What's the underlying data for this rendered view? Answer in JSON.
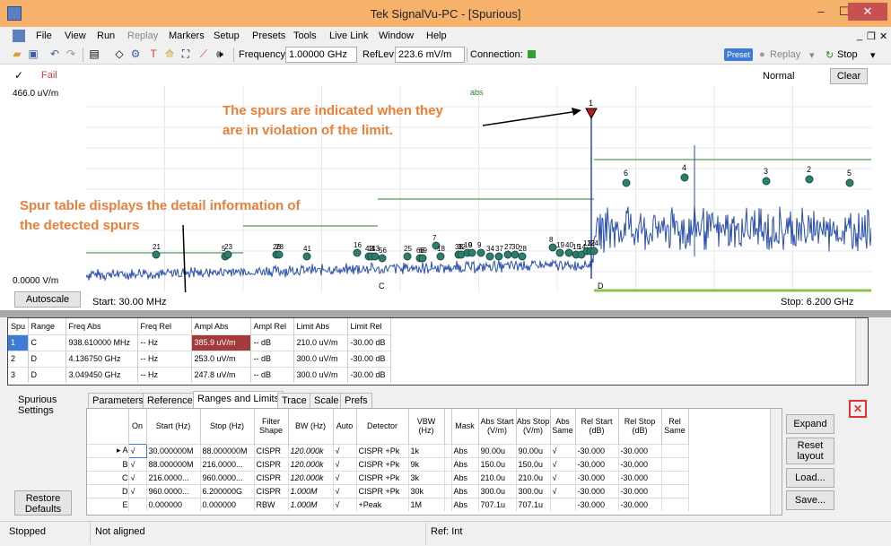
{
  "window": {
    "title": "Tek SignalVu-PC - [Spurious]",
    "minimize": "–",
    "maximize": "☐",
    "close": "✕"
  },
  "menu": [
    "File",
    "View",
    "Run",
    "Replay",
    "Markers",
    "Setup",
    "Presets",
    "Tools",
    "Live Link",
    "Window",
    "Help"
  ],
  "toolbar": {
    "frequency_label": "Frequency:",
    "frequency_value": "1.00000 GHz",
    "reflev_label": "RefLev:",
    "reflev_value": "223.6 mV/m",
    "connection_label": "Connection:",
    "connection_color": "#2ea32e",
    "preset_label": "Preset",
    "replay_label": "Replay",
    "stop_label": "Stop"
  },
  "status": {
    "check": "✓",
    "result": "Fail",
    "mode": "Normal",
    "clear_label": "Clear"
  },
  "plot": {
    "y_top": "466.0 uV/m",
    "y_bottom": "0.0000 V/m",
    "trace_label": "abs",
    "autoscale_label": "Autoscale",
    "start": "Start: 30.00 MHz",
    "stop": "Stop: 6.200 GHz",
    "range_c_label": "C",
    "range_d_label": "D",
    "markers_low": [
      "21",
      "5",
      "23",
      "26",
      "28",
      "41",
      "16",
      "42",
      "11",
      "43",
      "56",
      "25",
      "66",
      "69",
      "7",
      "18",
      "38",
      "32",
      "10",
      "9",
      "9",
      "34",
      "37",
      "27",
      "30",
      "28",
      "8",
      "19",
      "40",
      "15",
      "14",
      "13",
      "12",
      "24"
    ],
    "markers_high": [
      {
        "label": "1",
        "color": "#000000"
      },
      {
        "label": "6",
        "color": "#2e7d6e"
      },
      {
        "label": "4",
        "color": "#2e7d6e"
      },
      {
        "label": "3",
        "color": "#2e7d6e"
      },
      {
        "label": "2",
        "color": "#2e7d6e"
      },
      {
        "label": "5",
        "color": "#2e7d6e"
      }
    ],
    "trace_color": "#2a4fb0",
    "limit_color": "#2f7d32"
  },
  "annotations": {
    "spurs": [
      "The spurs are indicated when they",
      "are in violation of the limit."
    ],
    "table": [
      "Spur table displays the detail information of",
      "the detected spurs"
    ],
    "color": "#e8803a"
  },
  "spur_table": {
    "headers": [
      "Spu",
      "Range",
      "Freq Abs",
      "Freq Rel",
      "Ampl Abs",
      "Ampl Rel",
      "Limit Abs",
      "Limit Rel"
    ],
    "rows": [
      [
        "1",
        "C",
        "938.610000 MHz",
        "-- Hz",
        "385.9 uV/m",
        "-- dB",
        "210.0 uV/m",
        "-30.00 dB"
      ],
      [
        "2",
        "D",
        "4.136750 GHz",
        "-- Hz",
        "253.0 uV/m",
        "-- dB",
        "300.0 uV/m",
        "-30.00 dB"
      ],
      [
        "3",
        "D",
        "3.049450 GHz",
        "-- Hz",
        "247.8 uV/m",
        "-- dB",
        "300.0 uV/m",
        "-30.00 dB"
      ]
    ]
  },
  "settings": {
    "title_line1": "Spurious",
    "title_line2": "Settings",
    "tabs": [
      "Parameters",
      "Reference",
      "Ranges and Limits",
      "Trace",
      "Scale",
      "Prefs"
    ],
    "restore_line1": "Restore",
    "restore_line2": "Defaults",
    "buttons": [
      "Expand",
      "Reset layout",
      "Load...",
      "Save..."
    ],
    "close_icon": "✕",
    "range_headers": [
      "",
      "On",
      "Start (Hz)",
      "Stop (Hz)",
      "Filter Shape",
      "BW (Hz)",
      "Auto",
      "Detector",
      "VBW (Hz)",
      "",
      "Mask",
      "Abs Start (V/m)",
      "Abs Stop (V/m)",
      "Abs Same",
      "Rel Start (dB)",
      "Rel Stop (dB)",
      "Rel Same"
    ],
    "range_rows": [
      [
        "▸ A",
        "√",
        "30.000000M",
        "88.000000M",
        "CISPR",
        "120.000k",
        "√",
        "CISPR +Pk",
        "1k",
        "",
        "Abs",
        "90.00u",
        "90.00u",
        "√",
        "-30.000",
        "-30.000",
        ""
      ],
      [
        "B",
        "√",
        "88.000000M",
        "216.0000...",
        "CISPR",
        "120.000k",
        "√",
        "CISPR +Pk",
        "9k",
        "",
        "Abs",
        "150.0u",
        "150.0u",
        "√",
        "-30.000",
        "-30.000",
        ""
      ],
      [
        "C",
        "√",
        "216.0000...",
        "960.0000...",
        "CISPR",
        "120.000k",
        "√",
        "CISPR +Pk",
        "3k",
        "",
        "Abs",
        "210.0u",
        "210.0u",
        "√",
        "-30.000",
        "-30.000",
        ""
      ],
      [
        "D",
        "√",
        "960.0000...",
        "6.200000G",
        "CISPR",
        "1.000M",
        "√",
        "CISPR +Pk",
        "30k",
        "",
        "Abs",
        "300.0u",
        "300.0u",
        "√",
        "-30.000",
        "-30.000",
        ""
      ],
      [
        "E",
        "",
        "0.000000",
        "0.000000",
        "RBW",
        "1.000M",
        "√",
        "+Peak",
        "1M",
        "",
        "Abs",
        "707.1u",
        "707.1u",
        "",
        "-30.000",
        "-30.000",
        ""
      ]
    ]
  },
  "statusbar": {
    "state": "Stopped",
    "alignment": "Not aligned",
    "ref": "Ref: Int"
  }
}
